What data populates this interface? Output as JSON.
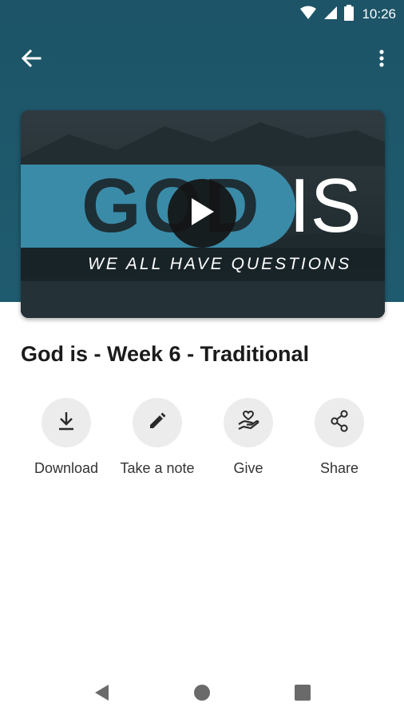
{
  "status_bar": {
    "time": "10:26"
  },
  "app_bar": {
    "back_icon": "arrow-left-icon",
    "menu_icon": "more-vert-icon"
  },
  "video": {
    "thumb_word_left": "GOD",
    "thumb_word_right": "IS",
    "tagline": "WE ALL HAVE QUESTIONS",
    "accent": "#3a8ba8"
  },
  "title": "God is - Week 6 - Traditional",
  "actions": [
    {
      "label": "Download",
      "icon": "download-icon"
    },
    {
      "label": "Take a note",
      "icon": "pencil-icon"
    },
    {
      "label": "Give",
      "icon": "heart-hand-icon"
    },
    {
      "label": "Share",
      "icon": "share-icon"
    }
  ],
  "nav": {
    "back": "back-triangle-icon",
    "home": "home-circle-icon",
    "recents": "recents-square-icon"
  }
}
